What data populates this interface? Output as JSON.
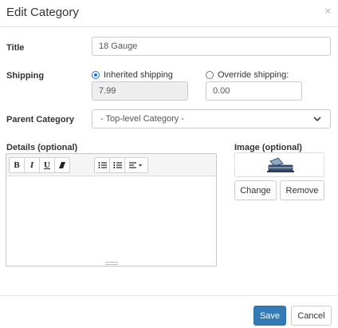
{
  "dialog": {
    "title": "Edit Category",
    "close_symbol": "×"
  },
  "form": {
    "title_label": "Title",
    "title_value": "18 Gauge",
    "shipping_label": "Shipping",
    "inherited_label": "Inherited shipping",
    "inherited_value": "7.99",
    "override_label": "Override shipping:",
    "override_value": "0.00",
    "shipping_mode": "inherited",
    "parent_label": "Parent Category",
    "parent_value": "- Top-level Category -",
    "details_label": "Details (optional)",
    "details_value": "",
    "image_label": "Image (optional)"
  },
  "toolbar": {
    "bold": "B",
    "italic": "I",
    "underline": "U",
    "clear_icon": "eraser-icon",
    "bullet_icon": "unordered-list-icon",
    "number_icon": "ordered-list-icon",
    "align_icon": "align-dropdown-icon"
  },
  "image_buttons": {
    "change": "Change",
    "remove": "Remove"
  },
  "footer": {
    "save": "Save",
    "cancel": "Cancel"
  },
  "colors": {
    "primary": "#337ab7",
    "radio_checked": "#1a73e8",
    "border": "#cccccc"
  }
}
